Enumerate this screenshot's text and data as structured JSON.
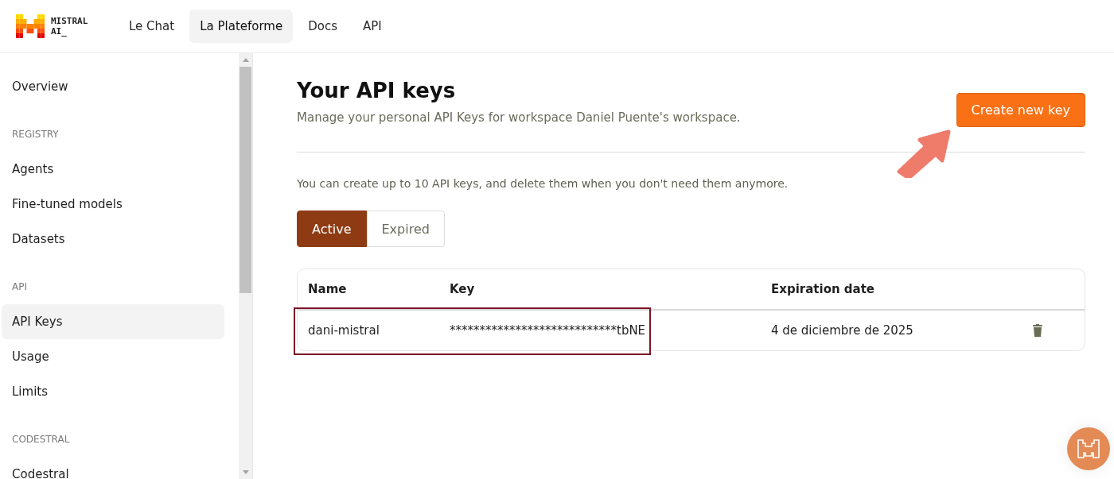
{
  "header": {
    "logo_lines": [
      "MISTRAL",
      "AI_"
    ],
    "nav": [
      {
        "label": "Le Chat",
        "selected": false
      },
      {
        "label": "La Plateforme",
        "selected": true
      },
      {
        "label": "Docs",
        "selected": false
      },
      {
        "label": "API",
        "selected": false
      }
    ]
  },
  "sidebar": {
    "items": [
      {
        "kind": "link",
        "label": "Overview",
        "selected": false
      },
      {
        "kind": "heading",
        "label": "REGISTRY"
      },
      {
        "kind": "link",
        "label": "Agents",
        "selected": false
      },
      {
        "kind": "link",
        "label": "Fine-tuned models",
        "selected": false
      },
      {
        "kind": "link",
        "label": "Datasets",
        "selected": false
      },
      {
        "kind": "heading",
        "label": "API"
      },
      {
        "kind": "link",
        "label": "API Keys",
        "selected": true
      },
      {
        "kind": "link",
        "label": "Usage",
        "selected": false
      },
      {
        "kind": "link",
        "label": "Limits",
        "selected": false
      },
      {
        "kind": "heading",
        "label": "CODESTRAL"
      },
      {
        "kind": "link",
        "label": "Codestral",
        "selected": false
      }
    ]
  },
  "main": {
    "title": "Your API keys",
    "subtitle": "Manage your personal API Keys for workspace Daniel Puente's workspace.",
    "create_button": "Create new key",
    "info": "You can create up to 10 API keys, and delete them when you don't need them anymore.",
    "tabs": [
      {
        "label": "Active",
        "selected": true
      },
      {
        "label": "Expired",
        "selected": false
      }
    ],
    "table": {
      "columns": [
        "Name",
        "Key",
        "Expiration date"
      ],
      "rows": [
        {
          "cells": [
            "dani-mistral",
            "****************************tbNE",
            "4 de diciembre de 2025"
          ],
          "highlighted": true
        }
      ]
    }
  },
  "arrow_annotation": true
}
